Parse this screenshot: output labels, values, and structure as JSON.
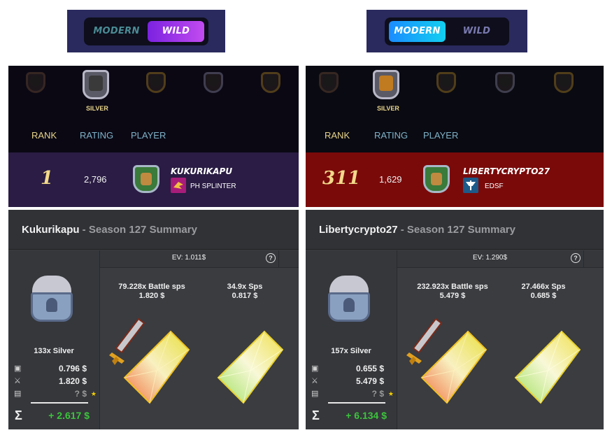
{
  "toggles": [
    {
      "modern": "MODERN",
      "wild": "WILD",
      "active": "wild"
    },
    {
      "modern": "MODERN",
      "wild": "WILD",
      "active": "modern"
    }
  ],
  "leagues": [
    {
      "league_name": "SILVER",
      "headers": {
        "rank": "RANK",
        "rating": "RATING",
        "player": "PLAYER"
      },
      "rank": "1",
      "rating": "2,796",
      "player": "KUKURIKAPU",
      "guild": "PH SPLINTER",
      "row_color": "#2a1c44"
    },
    {
      "league_name": "SILVER",
      "headers": {
        "rank": "RANK",
        "rating": "RATING",
        "player": "PLAYER"
      },
      "rank": "311",
      "rating": "1,629",
      "player": "LIBERTYCRYPTO27",
      "guild": "EDSF",
      "row_color": "#7a0a0a"
    }
  ],
  "summaries": [
    {
      "name": "Kukurikapu",
      "subtitle": " - Season 127 Summary",
      "ev": "EV: 1.011$",
      "chest_label": "133x Silver",
      "values": [
        "0.796 $",
        "1.820 $",
        "? $"
      ],
      "total": "+ 2.617 $",
      "reward1_line1": "79.228x Battle sps",
      "reward1_line2": "1.820 $",
      "reward2_line1": "34.9x Sps",
      "reward2_line2": "0.817 $"
    },
    {
      "name": "Libertycrypto27",
      "subtitle": " - Season 127 Summary",
      "ev": "EV: 1.290$",
      "chest_label": "157x Silver",
      "values": [
        "0.655 $",
        "5.479 $",
        "? $"
      ],
      "total": "+ 6.134 $",
      "reward1_line1": "232.923x Battle sps",
      "reward1_line2": "5.479 $",
      "reward2_line1": "27.466x Sps",
      "reward2_line2": "0.685 $"
    }
  ],
  "icons": {
    "sigma": "Σ",
    "help": "?",
    "star": "★",
    "chest": "chest-icon",
    "sword": "sword-icon",
    "vs": "vs-icon",
    "card": "card-icon"
  }
}
